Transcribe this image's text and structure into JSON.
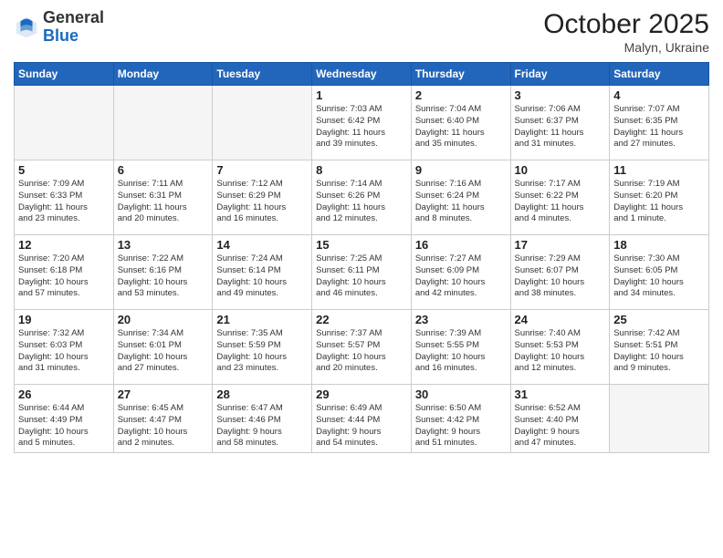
{
  "header": {
    "logo_general": "General",
    "logo_blue": "Blue",
    "month_title": "October 2025",
    "location": "Malyn, Ukraine"
  },
  "weekdays": [
    "Sunday",
    "Monday",
    "Tuesday",
    "Wednesday",
    "Thursday",
    "Friday",
    "Saturday"
  ],
  "weeks": [
    [
      {
        "day": "",
        "info": ""
      },
      {
        "day": "",
        "info": ""
      },
      {
        "day": "",
        "info": ""
      },
      {
        "day": "1",
        "info": "Sunrise: 7:03 AM\nSunset: 6:42 PM\nDaylight: 11 hours\nand 39 minutes."
      },
      {
        "day": "2",
        "info": "Sunrise: 7:04 AM\nSunset: 6:40 PM\nDaylight: 11 hours\nand 35 minutes."
      },
      {
        "day": "3",
        "info": "Sunrise: 7:06 AM\nSunset: 6:37 PM\nDaylight: 11 hours\nand 31 minutes."
      },
      {
        "day": "4",
        "info": "Sunrise: 7:07 AM\nSunset: 6:35 PM\nDaylight: 11 hours\nand 27 minutes."
      }
    ],
    [
      {
        "day": "5",
        "info": "Sunrise: 7:09 AM\nSunset: 6:33 PM\nDaylight: 11 hours\nand 23 minutes."
      },
      {
        "day": "6",
        "info": "Sunrise: 7:11 AM\nSunset: 6:31 PM\nDaylight: 11 hours\nand 20 minutes."
      },
      {
        "day": "7",
        "info": "Sunrise: 7:12 AM\nSunset: 6:29 PM\nDaylight: 11 hours\nand 16 minutes."
      },
      {
        "day": "8",
        "info": "Sunrise: 7:14 AM\nSunset: 6:26 PM\nDaylight: 11 hours\nand 12 minutes."
      },
      {
        "day": "9",
        "info": "Sunrise: 7:16 AM\nSunset: 6:24 PM\nDaylight: 11 hours\nand 8 minutes."
      },
      {
        "day": "10",
        "info": "Sunrise: 7:17 AM\nSunset: 6:22 PM\nDaylight: 11 hours\nand 4 minutes."
      },
      {
        "day": "11",
        "info": "Sunrise: 7:19 AM\nSunset: 6:20 PM\nDaylight: 11 hours\nand 1 minute."
      }
    ],
    [
      {
        "day": "12",
        "info": "Sunrise: 7:20 AM\nSunset: 6:18 PM\nDaylight: 10 hours\nand 57 minutes."
      },
      {
        "day": "13",
        "info": "Sunrise: 7:22 AM\nSunset: 6:16 PM\nDaylight: 10 hours\nand 53 minutes."
      },
      {
        "day": "14",
        "info": "Sunrise: 7:24 AM\nSunset: 6:14 PM\nDaylight: 10 hours\nand 49 minutes."
      },
      {
        "day": "15",
        "info": "Sunrise: 7:25 AM\nSunset: 6:11 PM\nDaylight: 10 hours\nand 46 minutes."
      },
      {
        "day": "16",
        "info": "Sunrise: 7:27 AM\nSunset: 6:09 PM\nDaylight: 10 hours\nand 42 minutes."
      },
      {
        "day": "17",
        "info": "Sunrise: 7:29 AM\nSunset: 6:07 PM\nDaylight: 10 hours\nand 38 minutes."
      },
      {
        "day": "18",
        "info": "Sunrise: 7:30 AM\nSunset: 6:05 PM\nDaylight: 10 hours\nand 34 minutes."
      }
    ],
    [
      {
        "day": "19",
        "info": "Sunrise: 7:32 AM\nSunset: 6:03 PM\nDaylight: 10 hours\nand 31 minutes."
      },
      {
        "day": "20",
        "info": "Sunrise: 7:34 AM\nSunset: 6:01 PM\nDaylight: 10 hours\nand 27 minutes."
      },
      {
        "day": "21",
        "info": "Sunrise: 7:35 AM\nSunset: 5:59 PM\nDaylight: 10 hours\nand 23 minutes."
      },
      {
        "day": "22",
        "info": "Sunrise: 7:37 AM\nSunset: 5:57 PM\nDaylight: 10 hours\nand 20 minutes."
      },
      {
        "day": "23",
        "info": "Sunrise: 7:39 AM\nSunset: 5:55 PM\nDaylight: 10 hours\nand 16 minutes."
      },
      {
        "day": "24",
        "info": "Sunrise: 7:40 AM\nSunset: 5:53 PM\nDaylight: 10 hours\nand 12 minutes."
      },
      {
        "day": "25",
        "info": "Sunrise: 7:42 AM\nSunset: 5:51 PM\nDaylight: 10 hours\nand 9 minutes."
      }
    ],
    [
      {
        "day": "26",
        "info": "Sunrise: 6:44 AM\nSunset: 4:49 PM\nDaylight: 10 hours\nand 5 minutes."
      },
      {
        "day": "27",
        "info": "Sunrise: 6:45 AM\nSunset: 4:47 PM\nDaylight: 10 hours\nand 2 minutes."
      },
      {
        "day": "28",
        "info": "Sunrise: 6:47 AM\nSunset: 4:46 PM\nDaylight: 9 hours\nand 58 minutes."
      },
      {
        "day": "29",
        "info": "Sunrise: 6:49 AM\nSunset: 4:44 PM\nDaylight: 9 hours\nand 54 minutes."
      },
      {
        "day": "30",
        "info": "Sunrise: 6:50 AM\nSunset: 4:42 PM\nDaylight: 9 hours\nand 51 minutes."
      },
      {
        "day": "31",
        "info": "Sunrise: 6:52 AM\nSunset: 4:40 PM\nDaylight: 9 hours\nand 47 minutes."
      },
      {
        "day": "",
        "info": ""
      }
    ]
  ]
}
